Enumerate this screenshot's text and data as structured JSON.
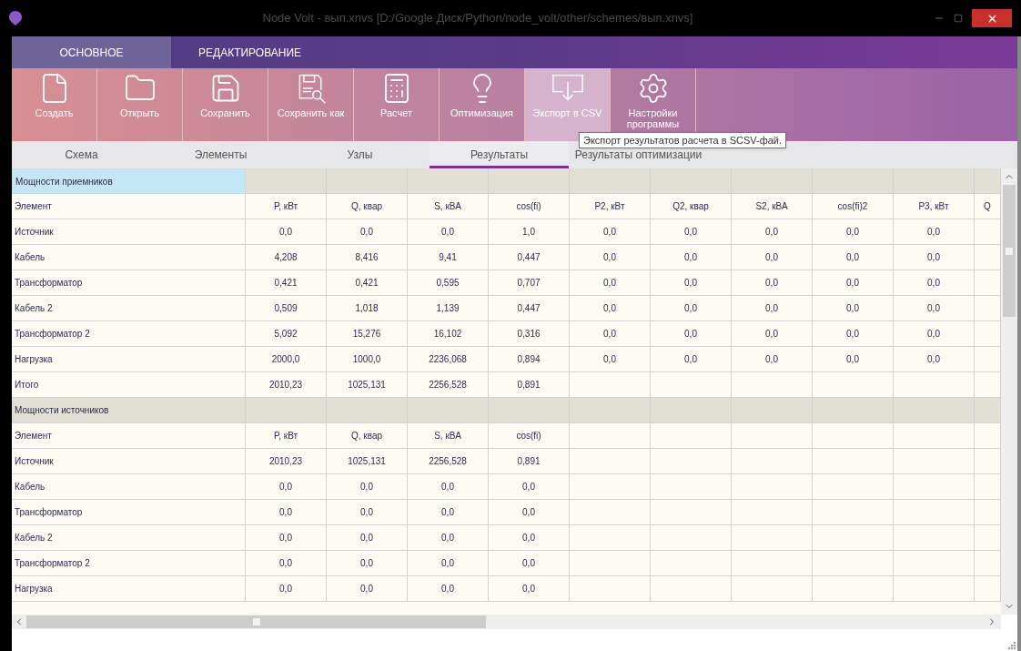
{
  "window": {
    "title": "Node Volt - вып.xnvs [D:/Google Диск/Python/node_volt/other/schemes/вып.xnvs]"
  },
  "ribbon_tabs": [
    {
      "label": "ОСНОВНОЕ",
      "selected": true
    },
    {
      "label": "РЕДАКТИРОВАНИЕ",
      "selected": false
    }
  ],
  "ribbon_buttons": [
    {
      "label": "Создать",
      "kind": "new",
      "highlighted": false
    },
    {
      "label": "Открыть",
      "kind": "open",
      "highlighted": false
    },
    {
      "label": "Сохранить",
      "kind": "save",
      "highlighted": false
    },
    {
      "label": "Сохранить как",
      "kind": "saveas",
      "highlighted": false
    },
    {
      "label": "Расчет",
      "kind": "calc",
      "highlighted": false
    },
    {
      "label": "Оптимизация",
      "kind": "optimize",
      "highlighted": false
    },
    {
      "label": "Экспорт в CSV",
      "kind": "export",
      "highlighted": true
    },
    {
      "label": "Настройки программы",
      "kind": "settings",
      "highlighted": false
    }
  ],
  "tooltip": "Экспорт результатов расчета в SCSV-фай.",
  "tabs": [
    {
      "label": "Схема",
      "selected": false
    },
    {
      "label": "Элементы",
      "selected": false
    },
    {
      "label": "Узлы",
      "selected": false
    },
    {
      "label": "Результаты",
      "selected": true
    },
    {
      "label": "Результаты оптимизации",
      "selected": false
    }
  ],
  "sections": [
    {
      "title": "Мощности приемников",
      "selected": true,
      "header": [
        "Элемент",
        "P, кВт",
        "Q, квар",
        "S, кВА",
        "cos(fi)",
        "P2, кВт",
        "Q2, квар",
        "S2, кВА",
        "cos(fi)2",
        "P3, кВт",
        "Q"
      ],
      "rows": [
        [
          "Источник",
          "0,0",
          "0,0",
          "0,0",
          "1,0",
          "0,0",
          "0,0",
          "0,0",
          "0,0",
          "0,0"
        ],
        [
          "Кабель",
          "4,208",
          "8,416",
          "9,41",
          "0,447",
          "0,0",
          "0,0",
          "0,0",
          "0,0",
          "0,0"
        ],
        [
          "Трансформатор",
          "0,421",
          "0,421",
          "0,595",
          "0,707",
          "0,0",
          "0,0",
          "0,0",
          "0,0",
          "0,0"
        ],
        [
          "Кабель 2",
          "0,509",
          "1,018",
          "1,139",
          "0,447",
          "0,0",
          "0,0",
          "0,0",
          "0,0",
          "0,0"
        ],
        [
          "Трансформатор 2",
          "5,092",
          "15,276",
          "16,102",
          "0,316",
          "0,0",
          "0,0",
          "0,0",
          "0,0",
          "0,0"
        ],
        [
          "Нагрузка",
          "2000,0",
          "1000,0",
          "2236,068",
          "0,894",
          "0,0",
          "0,0",
          "0,0",
          "0,0",
          "0,0"
        ],
        [
          "Итого",
          "2010,23",
          "1025,131",
          "2256,528",
          "0,891"
        ]
      ]
    },
    {
      "title": "Мощности источников",
      "selected": false,
      "header": [
        "Элемент",
        "P, кВт",
        "Q, квар",
        "S, кВА",
        "cos(fi)"
      ],
      "rows": [
        [
          "Источник",
          "2010,23",
          "1025,131",
          "2256,528",
          "0,891"
        ],
        [
          "Кабель",
          "0,0",
          "0,0",
          "0,0",
          "0,0"
        ],
        [
          "Трансформатор",
          "0,0",
          "0,0",
          "0,0",
          "0,0"
        ],
        [
          "Кабель 2",
          "0,0",
          "0,0",
          "0,0",
          "0,0"
        ],
        [
          "Трансформатор 2",
          "0,0",
          "0,0",
          "0,0",
          "0,0"
        ],
        [
          "Нагрузка",
          "0,0",
          "0,0",
          "0,0",
          "0,0"
        ]
      ]
    }
  ]
}
